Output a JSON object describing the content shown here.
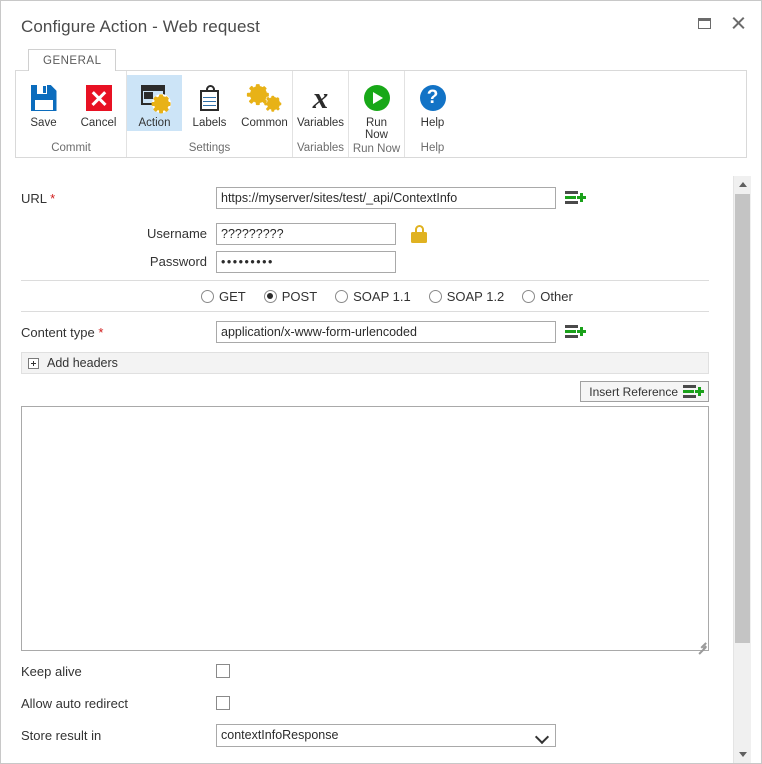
{
  "window": {
    "title": "Configure Action - Web request",
    "buttons": {
      "maximize": "maximize-window",
      "close": "close-window"
    }
  },
  "tabs": [
    {
      "label": "GENERAL",
      "selected": true
    }
  ],
  "ribbon": {
    "groups": [
      {
        "label": "Commit",
        "items": [
          {
            "label": "Save",
            "icon": "save-floppy-icon",
            "selected": false
          },
          {
            "label": "Cancel",
            "icon": "cancel-x-icon",
            "selected": false
          }
        ]
      },
      {
        "label": "Settings",
        "items": [
          {
            "label": "Action",
            "icon": "action-window-gear-icon",
            "selected": true
          },
          {
            "label": "Labels",
            "icon": "labels-tag-icon",
            "selected": false
          },
          {
            "label": "Common",
            "icon": "common-gears-icon",
            "selected": false
          }
        ]
      },
      {
        "label": "Variables",
        "items": [
          {
            "label": "Variables",
            "icon": "variables-x-icon",
            "selected": false
          }
        ]
      },
      {
        "label": "Run Now",
        "items": [
          {
            "label": "Run\nNow",
            "label_line1": "Run",
            "label_line2": "Now",
            "icon": "run-play-icon",
            "selected": false
          }
        ]
      },
      {
        "label": "Help",
        "items": [
          {
            "label": "Help",
            "icon": "help-question-icon",
            "selected": false
          }
        ]
      }
    ]
  },
  "form": {
    "url": {
      "label": "URL",
      "required": "*",
      "value": "https://myserver/sites/test/_api/ContextInfo",
      "placeholder": ""
    },
    "username": {
      "label": "Username",
      "value": "?????????",
      "placeholder": ""
    },
    "password": {
      "label": "Password",
      "value": "•••••••••",
      "placeholder": ""
    },
    "methods": {
      "options": [
        {
          "label": "GET",
          "selected": false
        },
        {
          "label": "POST",
          "selected": true
        },
        {
          "label": "SOAP 1.1",
          "selected": false
        },
        {
          "label": "SOAP 1.2",
          "selected": false
        },
        {
          "label": "Other",
          "selected": false
        }
      ]
    },
    "content_type": {
      "label": "Content type",
      "required": "*",
      "value": "application/x-www-form-urlencoded",
      "placeholder": ""
    },
    "add_headers": {
      "label": "Add headers",
      "expanded": false
    },
    "insert_reference": {
      "label": "Insert Reference"
    },
    "body": {
      "value": "",
      "placeholder": ""
    },
    "keep_alive": {
      "label": "Keep alive",
      "checked": false
    },
    "allow_auto_redirect": {
      "label": "Allow auto redirect",
      "checked": false
    },
    "store_result_in": {
      "label": "Store result in",
      "value": "contextInfoResponse",
      "options": [
        "contextInfoResponse"
      ]
    }
  },
  "colors": {
    "accent_blue": "#0b6cbd",
    "cancel_red": "#e81123",
    "gear_gold": "#e8b217",
    "run_green": "#18a818",
    "help_blue": "#1273c6",
    "lock_yellow": "#e0b221",
    "required_red": "#d01b1b",
    "tab_selected_bg": "#cce4f7"
  }
}
